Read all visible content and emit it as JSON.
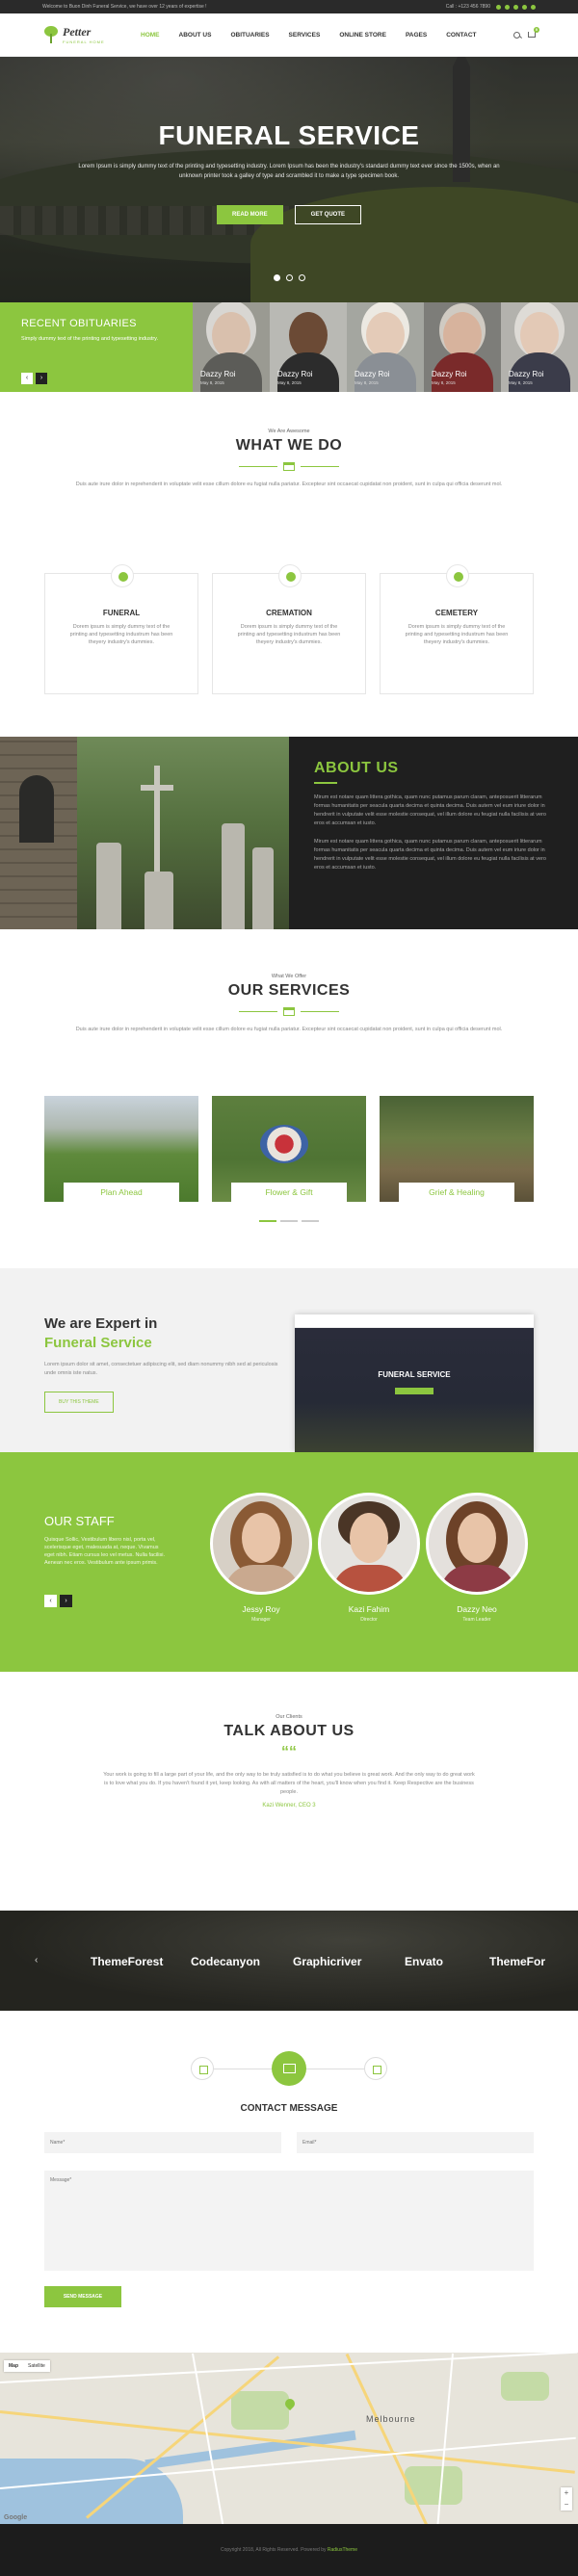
{
  "topbar": {
    "welcome": "Welcome to Buon Dinh Funeral Service, we have over 12 years of expertise !",
    "phone": "Call : +123 456 7890"
  },
  "header": {
    "logo_name": "Petter",
    "logo_sub": "FUNERAL HOME",
    "nav": [
      "HOME",
      "ABOUT US",
      "OBITUARIES",
      "SERVICES",
      "ONLINE STORE",
      "PAGES",
      "CONTACT"
    ],
    "cart_count": "0"
  },
  "hero": {
    "title": "FUNERAL SERVICE",
    "text": "Lorem Ipsum is simply dummy text of the printing and typesetting industry. Lorem Ipsum has been the industry's standard dummy text ever since the 1500s, when an unknown printer took a galley of type and scrambled it to make a type specimen book.",
    "btn_primary": "READ MORE",
    "btn_secondary": "GET QUOTE"
  },
  "obituaries": {
    "title": "RECENT OBITUARIES",
    "text": "Simply dummy text of the printing and typesetting industry.",
    "people": [
      {
        "name": "Dazzy Roi",
        "date": "May 8, 2015"
      },
      {
        "name": "Dazzy Roi",
        "date": "May 8, 2015"
      },
      {
        "name": "Dazzy Roi",
        "date": "May 8, 2015"
      },
      {
        "name": "Dazzy Roi",
        "date": "May 8, 2015"
      },
      {
        "name": "Dazzy Roi",
        "date": "May 8, 2015"
      }
    ]
  },
  "whatwedo": {
    "label": "We Are Awesome",
    "title": "WHAT WE DO",
    "desc": "Duis aute irure dolor in reprehenderit in voluptate velit esse cillum dolore eu fugiat nulla pariatur. Excepteur sint occaecat cupidatat non proident, sunt in culpa qui officia deserunt mol.",
    "cards": [
      {
        "title": "FUNERAL",
        "text": "Dorem ipsum is simply dummy text of the printing and typesetting industrum has been theyery industry's dummies."
      },
      {
        "title": "CREMATION",
        "text": "Dorem ipsum is simply dummy text of the printing and typesetting industrum has been theyery industry's dummies."
      },
      {
        "title": "CEMETERY",
        "text": "Dorem ipsum is simply dummy text of the printing and typesetting industrum has been theyery industry's dummies."
      }
    ]
  },
  "about": {
    "title": "ABOUT US",
    "p1": "Mirum est notare quam littera gothica, quam nunc putamus parum claram, anteposuerit litterarum formas humanitatis per seacula quarta decima et quinta decima. Duis autem vel eum iriure dolor in hendrerit in vulputate velit esse molestie consequat, vel illum dolore eu feugiat nulla facilisis at vero eros et accumsan et iusto.",
    "p2": "Mirum est notare quam littera gothica, quam nunc putamus parum claram, anteposuerit litterarum formas humanitatis per seacula quarta decima et quinta decima. Duis autem vel eum iriure dolor in hendrerit in vulputate velit esse molestie consequat, vel illum dolore eu feugiat nulla facilisis at vero eros et accumsan et iusto."
  },
  "services": {
    "label": "What We Offer",
    "title": "OUR SERVICES",
    "desc": "Duis aute irure dolor in reprehenderit in voluptate velit esse cillum dolore eu fugiat nulla pariatur. Excepteur sint occaecat cupidatat non proident, sunt in culpa qui officia deserunt mol.",
    "items": [
      "Plan Ahead",
      "Flower & Gift",
      "Grief & Healing"
    ]
  },
  "expert": {
    "title_line1": "We are Expert in",
    "title_line2": "Funeral Service",
    "text": "Lorem ipsum dolor sit amet, consectetuer adipiscing elit, sed diam nonummy nibh sed at periculosis unde omnis iste natus.",
    "button": "BUY THIS THEME",
    "screen_title": "FUNERAL SERVICE"
  },
  "staff": {
    "title": "OUR STAFF",
    "text": "Quisque Sollic, Vestibulum libero nisl, porta vel, scelerisque eget, malesuada at, neque. Vivamus eget nibh. Etiam cursus leo vel metus. Nulla facilisi. Aenean nec eros. Vestibulum ante ipsum primis.",
    "members": [
      {
        "name": "Jessy Roy",
        "role": "Manager"
      },
      {
        "name": "Kazi Fahim",
        "role": "Director"
      },
      {
        "name": "Dazzy Neo",
        "role": "Team Leader"
      }
    ]
  },
  "testimonial": {
    "label": "Our Clients",
    "title": "TALK ABOUT US",
    "quote": "““",
    "text": "Your work is going to fill a large part of your life, and the only way to be truly satisfied is to do what you believe is great work. And the only way to do great work is to love what you do. If you haven't found it yet, keep looking. As with all matters of the heart, you'll know when you find it. Keep Respective are the business people.",
    "author": "Kazi Wenner, CEO 3"
  },
  "partners": {
    "items": [
      "ThemeForest",
      "Codecanyon",
      "Graphicriver",
      "Envato",
      "ThemeFor"
    ],
    "prev": "‹"
  },
  "contact": {
    "title": "CONTACT MESSAGE",
    "name_placeholder": "Name*",
    "email_placeholder": "Email*",
    "message_placeholder": "Message*",
    "send": "SEND MESSAGE"
  },
  "map": {
    "tab_map": "Map",
    "tab_satellite": "Satellite",
    "city": "Melbourne",
    "google": "Google"
  },
  "footer": {
    "text": "Copyright 2018, All Rights Reserved. Powered by",
    "brand": "RadiusTheme"
  },
  "colors": {
    "accent": "#8cc63f",
    "dark": "#1f1f1f"
  }
}
